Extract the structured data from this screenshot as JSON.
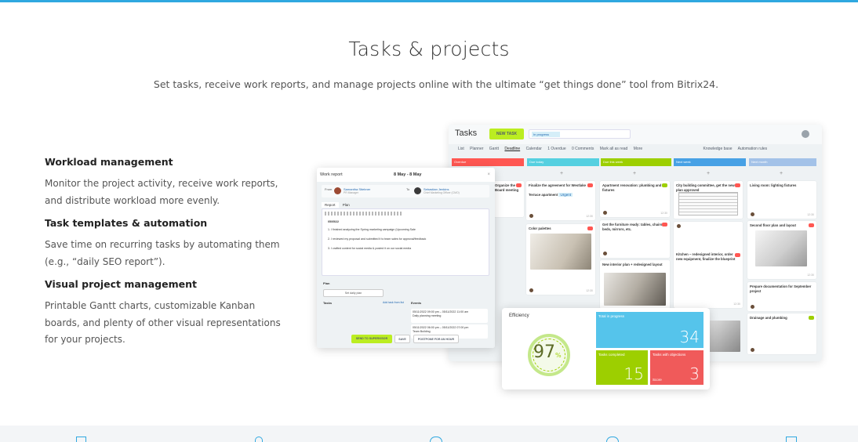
{
  "colors": {
    "accent": "#2fa8e0",
    "green": "#9dcf00",
    "red": "#ff5752",
    "blue": "#55d0e0"
  },
  "header": {
    "title": "Tasks & projects",
    "subtitle": "Set tasks, receive work reports, and manage projects online with the ultimate “get things done” tool from Bitrix24."
  },
  "features": [
    {
      "title": "Workload management",
      "desc": "Monitor the project activity, receive work reports, and distribute workload more evenly."
    },
    {
      "title": "Task templates & automation",
      "desc": "Save time on recurring tasks by automating them (e.g., “daily SEO report”)."
    },
    {
      "title": "Visual project management",
      "desc": "Printable Gantt charts, customizable Kanban boards, and plenty of other visual representations for your projects."
    }
  ],
  "kanban": {
    "title": "Tasks",
    "new_task": "NEW TASK",
    "filter_chip": "In progress",
    "tabs": [
      "List",
      "Planner",
      "Gantt",
      "Deadline",
      "Calendar",
      "1  Overdue",
      "0  Comments",
      "Mark all as read",
      "More"
    ],
    "right_tabs": [
      "Knowledge base",
      "Automation rules"
    ],
    "columns": [
      "Overdue",
      "Due today",
      "Due this week",
      "Next week",
      "Next month"
    ],
    "cards": [
      {
        "title": "Organize the Board meeting"
      },
      {
        "title": "Finalize the agreement for Westlake Terrace apartment",
        "tag": "Urgent"
      },
      {
        "title": "Color palettes"
      },
      {
        "title": "Apartment renovation: plumbing and fixtures"
      },
      {
        "title": "Get the furniture ready: tables, chairs, beds, mirrors, etc."
      },
      {
        "title": "New interior plan + redesigned layout"
      },
      {
        "title": "City building committee, get the new plan approved"
      },
      {
        "title": "Kitchen – redesigned interior, order new equipment, finalize the blueprint"
      },
      {
        "title": "Living room: lighting fixtures"
      },
      {
        "title": "Second floor plan and layout"
      },
      {
        "title": "Prepare documentation for September project"
      },
      {
        "title": "Drainage and plumbing"
      }
    ],
    "times": [
      "12:30",
      "12:30",
      "12:30",
      "12:30",
      "12:30",
      "12:30"
    ]
  },
  "report": {
    "title": "Work report",
    "period": "8 May - 8 May",
    "from_label": "From",
    "from_name": "Samantha Stiebner",
    "from_role": "PR Manager",
    "to_label": "To",
    "to_name": "Sebastian Jenkins",
    "to_role": "Chief Marketing Officer (CMO)",
    "tabs": [
      "Report",
      "Plan"
    ],
    "date": "05/05/22",
    "lines": [
      "1. I finished analyzing the Spring marketing campaign (Upcoming Sale",
      "2. I reviewed my proposal and submitted it to team sales for approval/feedback",
      "3. I crafted content for social media & posted it on our social media"
    ],
    "plan_label": "Plan",
    "plan_button": "Set daily plan",
    "tasks_label": "Tasks",
    "tasks_link": "Add task from list",
    "events_label": "Events",
    "events": [
      {
        "time": "05/11/2022 09:00 pm – 05/11/2022 11:00 am",
        "name": "Daily planning meeting"
      },
      {
        "time": "05/11/2022 06:00 pm – 05/11/2022 07:00 pm",
        "name": "Team Building"
      }
    ],
    "buttons": [
      "SEND TO SUPERVISOR",
      "SAVE",
      "POSTPONE FOR AN HOUR"
    ]
  },
  "efficiency": {
    "title": "Efficiency",
    "percent": "97",
    "percent_sign": "%",
    "tiles": [
      {
        "label": "Total in progress",
        "value": "34"
      },
      {
        "label": "Tasks completed",
        "value": "15"
      },
      {
        "label": "Tasks with objections",
        "value": "3",
        "sub": "Score"
      }
    ]
  }
}
